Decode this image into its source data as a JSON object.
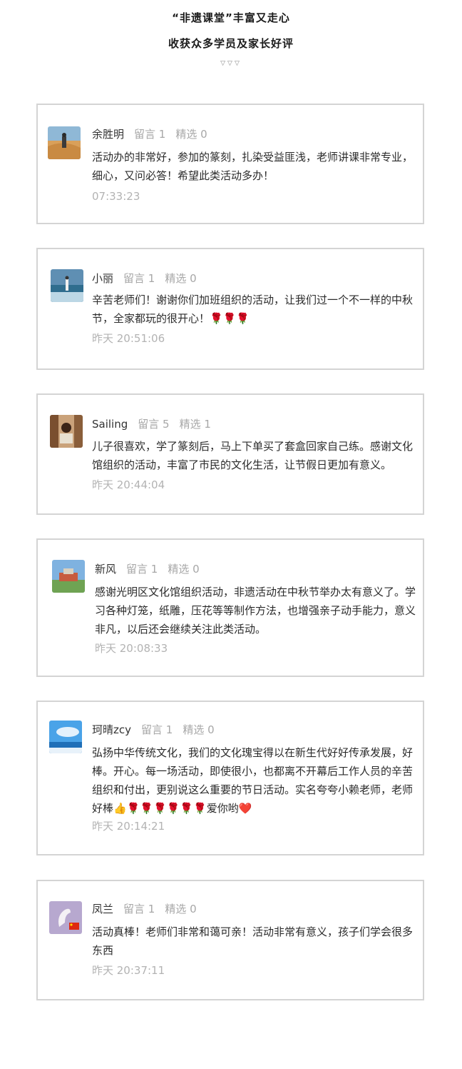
{
  "header": {
    "title_line1": "“非遗课堂”丰富又走心",
    "title_line2": "收获众多学员及家长好评",
    "arrows": "▽▽▽"
  },
  "comments": [
    {
      "name": "余胜明",
      "messages": "留言 1",
      "featured": "精选 0",
      "text": "活动办的非常好，参加的篆刻，扎染受益匪浅，老师讲课非常专业，细心，又问必答！希望此类活动多办！",
      "time": "07:33:23",
      "avatar_icon": "desert-person-photo"
    },
    {
      "name": "小丽",
      "messages": "留言 1",
      "featured": "精选 0",
      "text": "辛苦老师们！谢谢你们加班组织的活动，让我们过一个不一样的中秋节，全家都玩的很开心！🌹🌹🌹",
      "time": "昨天 20:51:06",
      "avatar_icon": "sea-person-photo"
    },
    {
      "name": "Sailing",
      "messages": "留言 5",
      "featured": "精选 1",
      "text": "儿子很喜欢，学了篆刻后，马上下单买了套盒回家自己练。感谢文化馆组织的活动，丰富了市民的文化生活，让节假日更加有意义。",
      "time": "昨天 20:44:04",
      "avatar_icon": "reading-person-photo"
    },
    {
      "name": "新风",
      "messages": "留言 1",
      "featured": "精选 0",
      "text": "感谢光明区文化馆组织活动，非遗活动在中秋节举办太有意义了。学习各种灯笼，纸雕，压花等等制作方法，也增强亲子动手能力，意义非凡，以后还会继续关注此类活动。",
      "time": "昨天 20:08:33",
      "avatar_icon": "building-landscape-photo"
    },
    {
      "name": "珂晴zcy",
      "messages": "留言 1",
      "featured": "精选 0",
      "text": "弘扬中华传统文化，我们的文化瑰宝得以在新生代好好传承发展，好棒。开心。每一场活动，即使很小，也都离不开幕后工作人员的辛苦组织和付出，更别说这么重要的节日活动。实名夸夸小赖老师，老师好棒👍🌹🌹🌹🌹🌹🌹爱你哟❤️",
      "time": "昨天 20:14:21",
      "avatar_icon": "sky-sea-photo"
    },
    {
      "name": "凤兰",
      "messages": "留言 1",
      "featured": "精选 0",
      "text": "活动真棒！老师们非常和蔼可亲！活动非常有意义，孩子们学会很多东西",
      "time": "昨天 20:37:11",
      "avatar_icon": "swan-flag-photo"
    }
  ]
}
